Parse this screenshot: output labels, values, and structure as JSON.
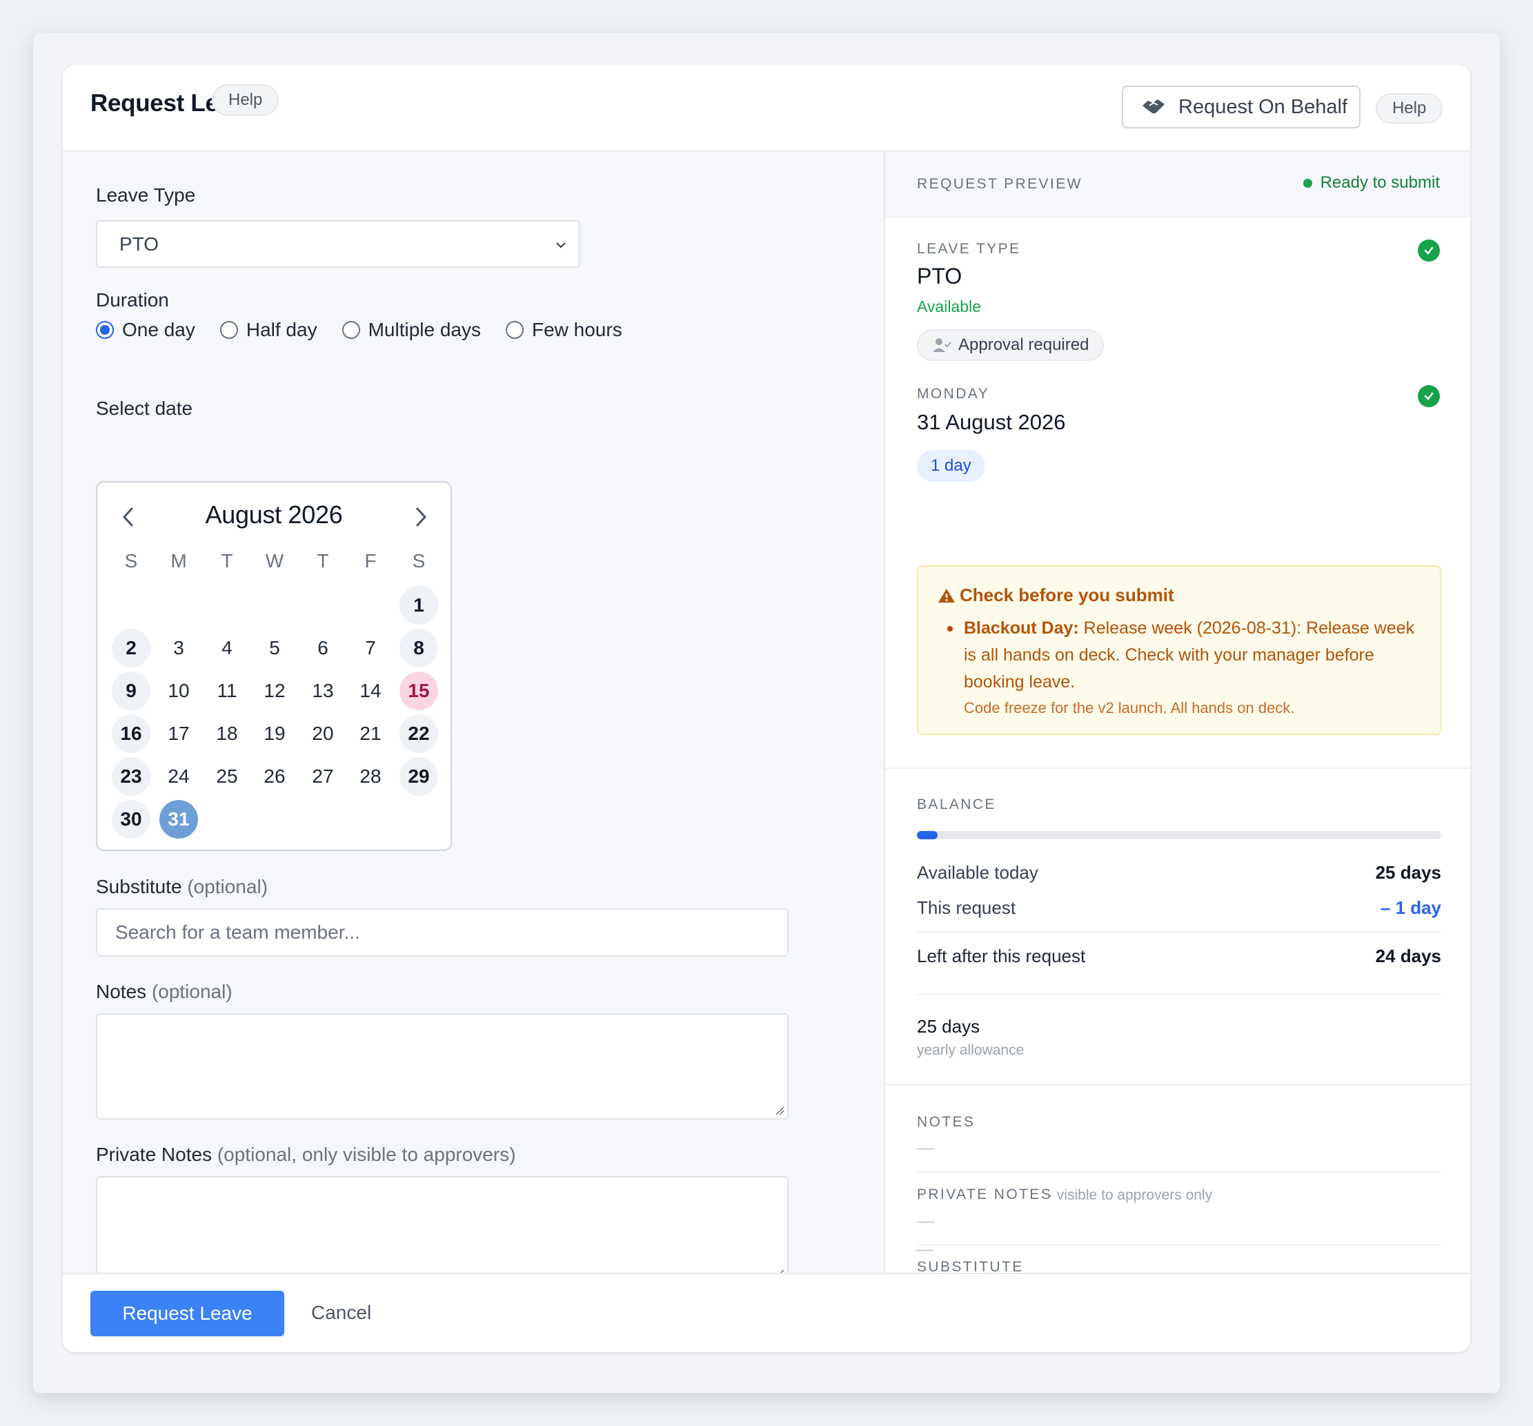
{
  "header": {
    "title": "Request Leave",
    "help_left": "Help",
    "on_behalf_label": "Request On Behalf",
    "help_right": "Help"
  },
  "form": {
    "leave_type_label": "Leave Type",
    "leave_type_value": "PTO",
    "duration_label": "Duration",
    "duration_options": [
      "One day",
      "Half day",
      "Multiple days",
      "Few hours"
    ],
    "duration_selected": "One day",
    "select_date_label": "Select date",
    "calendar": {
      "month_title": "August 2026",
      "weekdays": [
        "S",
        "M",
        "T",
        "W",
        "T",
        "F",
        "S"
      ],
      "days": [
        "1",
        "2",
        "3",
        "4",
        "5",
        "6",
        "7",
        "8",
        "9",
        "10",
        "11",
        "12",
        "13",
        "14",
        "15",
        "16",
        "17",
        "18",
        "19",
        "20",
        "21",
        "22",
        "23",
        "24",
        "25",
        "26",
        "27",
        "28",
        "29",
        "30",
        "31"
      ],
      "selected_day": "31",
      "highlighted_day": "15"
    },
    "substitute_label": "Substitute",
    "substitute_optional": "(optional)",
    "substitute_placeholder": "Search for a team member...",
    "notes_label": "Notes",
    "notes_optional": "(optional)",
    "private_notes_label": "Private Notes",
    "private_notes_optional": "(optional, only visible to approvers)"
  },
  "footer": {
    "submit_label": "Request Leave",
    "cancel_label": "Cancel"
  },
  "preview": {
    "heading": "REQUEST PREVIEW",
    "status": "Ready to submit",
    "leave_type_caption": "LEAVE TYPE",
    "leave_type_value": "PTO",
    "leave_type_availability": "Available",
    "approval_chip": "Approval required",
    "weekday_caption": "MONDAY",
    "date_value": "31 August 2026",
    "duration_chip": "1 day",
    "warning": {
      "title": "Check before you submit",
      "item_label": "Blackout Day:",
      "item_text": "Release week (2026-08-31): Release week is all hands on deck. Check with your manager before booking leave.",
      "item_note": "Code freeze for the v2 launch. All hands on deck."
    },
    "balance": {
      "heading": "BALANCE",
      "used_fraction": 0.04,
      "available_label": "Available today",
      "available_value": "25 days",
      "request_label": "This request",
      "request_value": "– 1 day",
      "left_label": "Left after this request",
      "left_value": "24 days",
      "allowance_value": "25 days",
      "allowance_caption": "yearly allowance"
    },
    "notes_heading": "NOTES",
    "notes_value": "—",
    "private_notes_heading": "PRIVATE NOTES",
    "private_notes_caption": "· visible to approvers only",
    "private_notes_value": "—",
    "substitute_heading": "SUBSTITUTE",
    "substitute_value": "—"
  },
  "colors": {
    "primary": "#3b82f6",
    "selected_day": "#6e9fd6",
    "highlight_day": "#fbd5e2",
    "success": "#16a34a",
    "warning": "#b4530a"
  }
}
